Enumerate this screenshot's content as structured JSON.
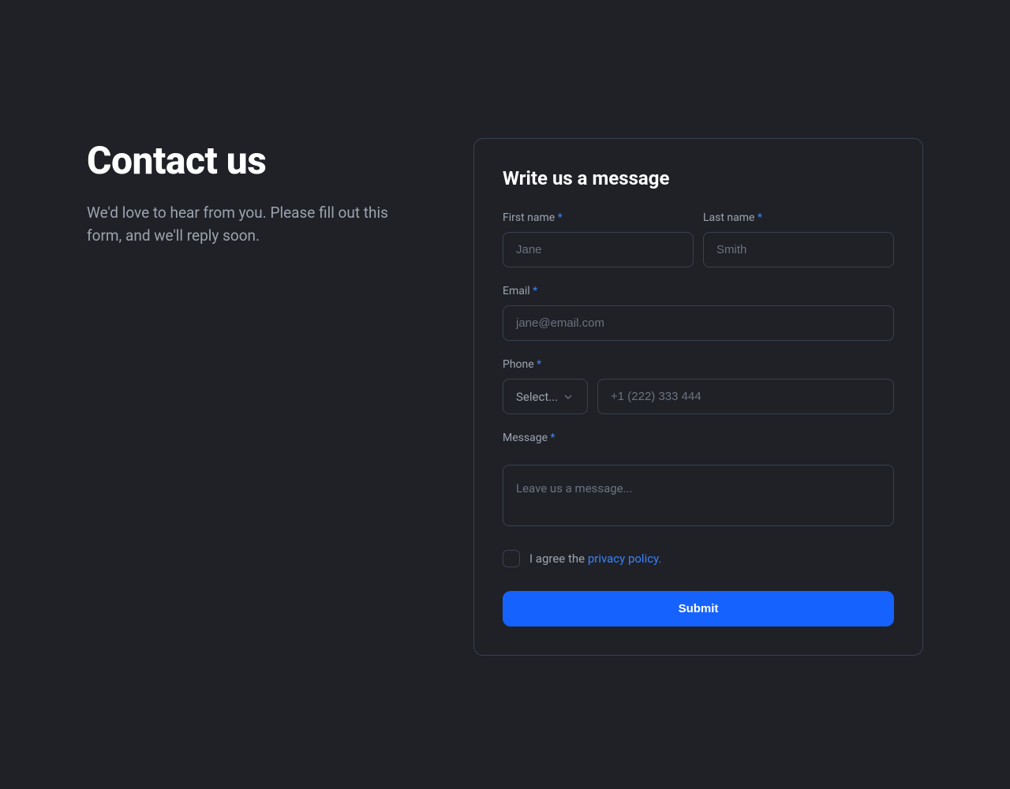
{
  "header": {
    "title": "Contact us",
    "subtitle": "We'd love to hear from you. Please fill out this form, and we'll reply soon."
  },
  "form": {
    "title": "Write us a message",
    "fields": {
      "first_name": {
        "label": "First name",
        "placeholder": "Jane"
      },
      "last_name": {
        "label": "Last name",
        "placeholder": "Smith"
      },
      "email": {
        "label": "Email",
        "placeholder": "jane@email.com"
      },
      "phone": {
        "label": "Phone",
        "select_placeholder": "Select...",
        "input_placeholder": "+1 (222) 333 444"
      },
      "message": {
        "label": "Message",
        "placeholder": "Leave us a message..."
      }
    },
    "agreement": {
      "prefix": "I agree the ",
      "link": "privacy policy."
    },
    "submit_label": "Submit",
    "required_marker": "*"
  }
}
